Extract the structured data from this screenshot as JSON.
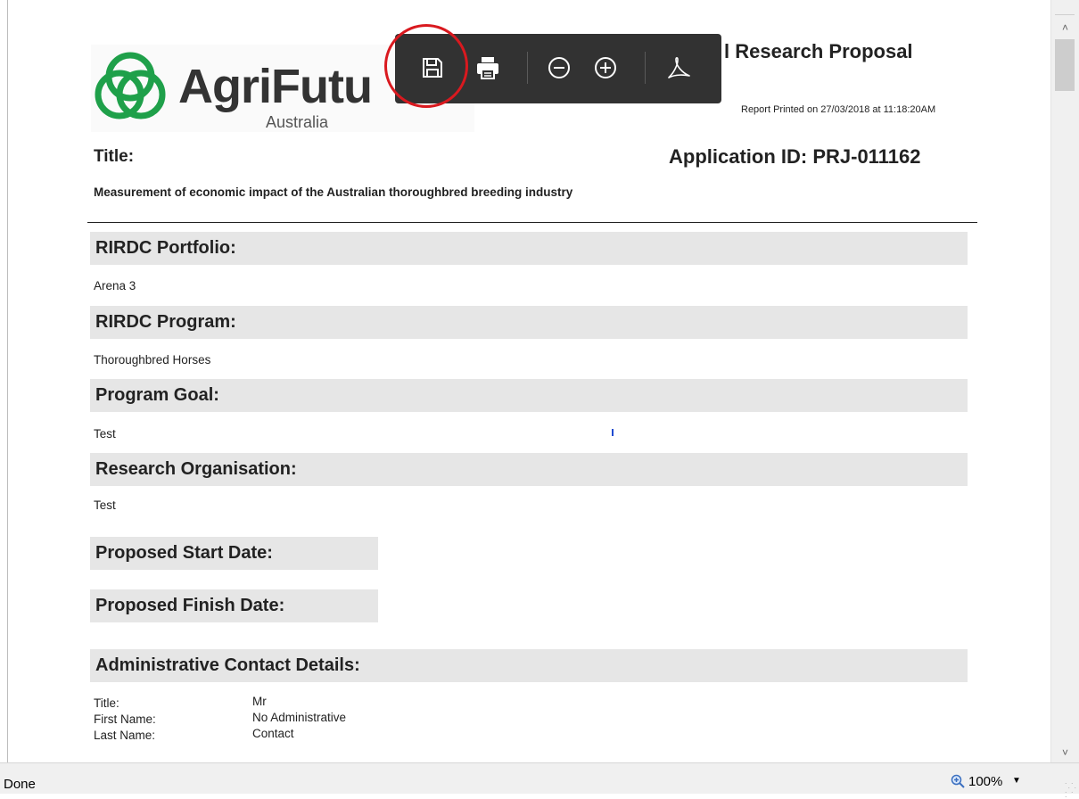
{
  "report": {
    "logo_text": "AgriFutu",
    "logo_subtext": "Australia",
    "heading": "l Research Proposal",
    "printed_on": "Report Printed on 27/03/2018 at 11:18:20AM",
    "title_label": "Title:",
    "application_id": "Application ID: PRJ-011162",
    "project_title": "Measurement of economic impact of the Australian thoroughbred breeding industry"
  },
  "sections": [
    {
      "heading": "RIRDC Portfolio:",
      "value": "Arena 3"
    },
    {
      "heading": "RIRDC Program:",
      "value": "Thoroughbred Horses"
    },
    {
      "heading": "Program Goal:",
      "value": "Test"
    },
    {
      "heading": "Research Organisation:",
      "value": "Test"
    },
    {
      "heading": "Proposed Start Date:",
      "value": ""
    },
    {
      "heading": "Proposed Finish Date:",
      "value": ""
    },
    {
      "heading": "Administrative Contact Details:",
      "value": ""
    }
  ],
  "admin_contact": [
    {
      "label": "Title:",
      "value": "Mr"
    },
    {
      "label": "First Name:",
      "value": "No Administrative"
    },
    {
      "label": "Last Name:",
      "value": "Contact"
    }
  ],
  "toolbar": {
    "buttons": [
      "save-icon",
      "print-icon",
      "zoom-out-icon",
      "zoom-in-icon",
      "adobe-pdf-icon"
    ],
    "highlight_color": "#d9191f",
    "background": "#323232"
  },
  "statusbar": {
    "status": "Done",
    "zoom": "100%"
  },
  "colors": {
    "logo_green": "#1fa04a",
    "section_bg": "#e6e6e6"
  }
}
